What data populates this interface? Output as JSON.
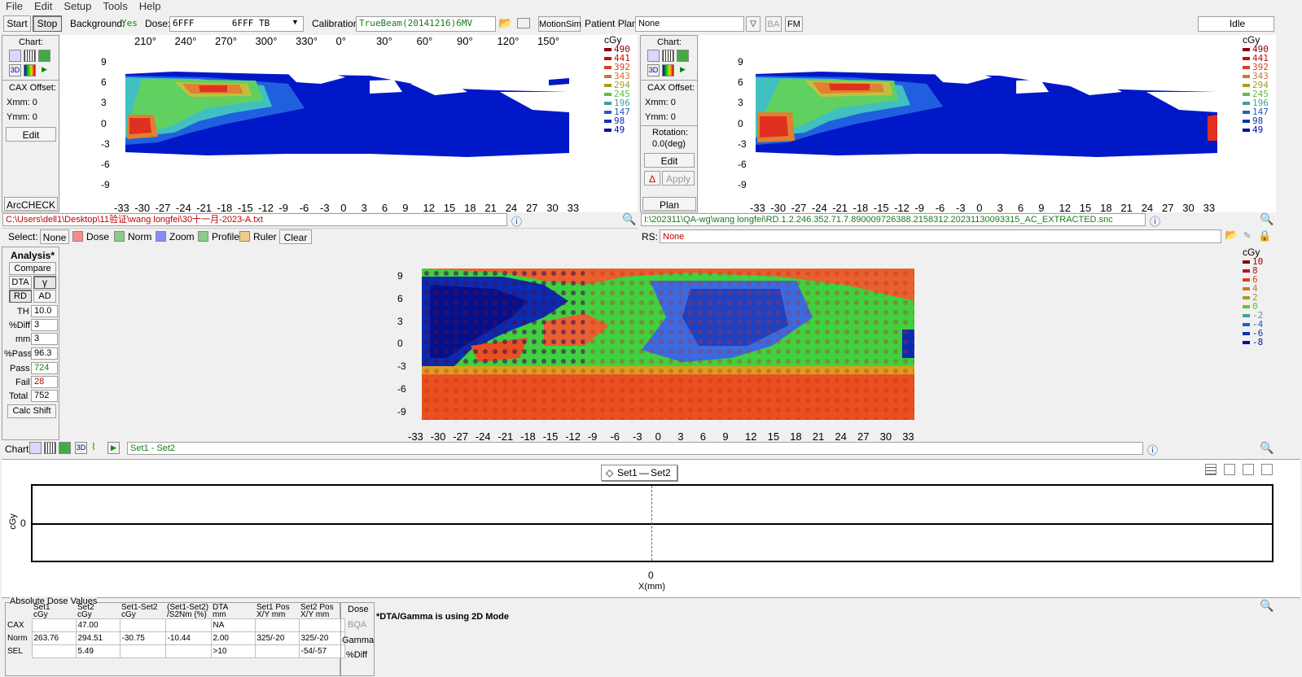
{
  "menu": [
    "File",
    "Edit",
    "Setup",
    "Tools",
    "Help"
  ],
  "toolbar": {
    "start": "Start",
    "stop": "Stop",
    "background_label": "Background:",
    "background_value": "Yes",
    "dose_label": "Dose:",
    "dose_value": "6FFF       6FFF TB",
    "calibration_label": "Calibration:",
    "calibration_value": "TrueBeam(20141216)6MV",
    "motionsim": "MotionSim",
    "patient_plan_label": "Patient Plan:",
    "patient_plan_value": "None",
    "ba": "BA",
    "fm": "FM",
    "status": "Idle"
  },
  "left_panel": {
    "chart_label": "Chart:",
    "cax_offset": "CAX Offset:",
    "xmm": "Xmm: 0",
    "ymm": "Ymm: 0",
    "edit": "Edit",
    "arccheck": "ArcCHECK",
    "angle_ticks": [
      "210°",
      "240°",
      "270°",
      "300°",
      "330°",
      "0°",
      "30°",
      "60°",
      "90°",
      "120°",
      "150°"
    ],
    "y_ticks": [
      "9",
      "6",
      "3",
      "0",
      "-3",
      "-6",
      "-9"
    ],
    "x_ticks": [
      "-33",
      "-30",
      "-27",
      "-24",
      "-21",
      "-18",
      "-15",
      "-12",
      "-9",
      "-6",
      "-3",
      "0",
      "3",
      "6",
      "9",
      "12",
      "15",
      "18",
      "21",
      "24",
      "27",
      "30",
      "33"
    ],
    "file_path": "C:\\Users\\dell1\\Desktop\\11验证\\wang longfei\\30十一月-2023-A.txt",
    "select_label": "Select:",
    "select_none": "None",
    "select_dose": "Dose",
    "select_norm": "Norm",
    "select_zoom": "Zoom",
    "select_profile": "Profile",
    "select_ruler": "Ruler",
    "select_clear": "Clear"
  },
  "right_panel": {
    "chart_label": "Chart:",
    "cax_offset": "CAX Offset:",
    "xmm": "Xmm: 0",
    "ymm": "Ymm: 0",
    "rotation_label": "Rotation:",
    "rotation_value": "0.0(deg)",
    "edit": "Edit",
    "apply": "Apply",
    "plan": "Plan",
    "file_path": "I:\\202311\\QA-wg\\wang longfei\\RD.1.2.246.352.71.7.890009726388.2158312.20231130093315_AC_EXTRACTED.snc",
    "rs_label": "RS:",
    "rs_value": "None"
  },
  "dose_legend": {
    "unit": "cGy",
    "values": [
      "490",
      "441",
      "392",
      "343",
      "294",
      "245",
      "196",
      "147",
      "98",
      "49"
    ],
    "colors": [
      "#8b0000",
      "#c01010",
      "#d84020",
      "#c87830",
      "#a0a020",
      "#60c040",
      "#40a0a0",
      "#2060c0",
      "#1030b0",
      "#0010a0"
    ]
  },
  "analysis": {
    "title": "Analysis*",
    "compare": "Compare",
    "dta": "DTA",
    "gamma": "γ",
    "rd": "RD",
    "ad": "AD",
    "th_label": "TH",
    "th_value": "10.0",
    "diff_label": "%Diff",
    "diff_value": "3",
    "mm_label": "mm",
    "mm_value": "3",
    "pass_pct_label": "%Pass",
    "pass_pct_value": "96.3",
    "pass_label": "Pass",
    "pass_value": "724",
    "fail_label": "Fail",
    "fail_value": "28",
    "total_label": "Total",
    "total_value": "752",
    "calc_shift": "Calc Shift",
    "y_ticks": [
      "9",
      "6",
      "3",
      "0",
      "-3",
      "-6",
      "-9"
    ],
    "x_ticks": [
      "-33",
      "-30",
      "-27",
      "-24",
      "-21",
      "-18",
      "-15",
      "-12",
      "-9",
      "-6",
      "-3",
      "0",
      "3",
      "6",
      "9",
      "12",
      "15",
      "18",
      "21",
      "24",
      "27",
      "30",
      "33"
    ],
    "chart_label": "Chart:",
    "set_label": "Set1 - Set2",
    "diff_legend": {
      "unit": "cGy",
      "values": [
        "10",
        "8",
        "6",
        "4",
        "2",
        "0",
        "-2",
        "-4",
        "-6",
        "-8"
      ],
      "colors": [
        "#8b0000",
        "#c01010",
        "#d84020",
        "#c87830",
        "#a0a020",
        "#60c040",
        "#40a0a0",
        "#2060c0",
        "#1030b0",
        "#0010a0"
      ]
    }
  },
  "profile": {
    "legend_set1": "Set1",
    "legend_set2": "Set2",
    "ylabel": "cGy",
    "y0": "0",
    "x0": "0",
    "xlabel": "X(mm)"
  },
  "bottom": {
    "group_title": "Absolute Dose Values",
    "headers": [
      [
        "Set1",
        "cGy"
      ],
      [
        "Set2",
        "cGy"
      ],
      [
        "Set1-Set2",
        "cGy"
      ],
      [
        "(Set1-Set2)",
        "/S2Nm (%)"
      ],
      [
        "DTA",
        "mm"
      ],
      [
        "Set1 Pos",
        "X/Y mm"
      ],
      [
        "Set2 Pos",
        "X/Y mm"
      ]
    ],
    "rows": [
      {
        "label": "CAX",
        "values": [
          "",
          "47.00",
          "",
          "",
          "NA",
          "",
          ""
        ]
      },
      {
        "label": "Norm",
        "values": [
          "263.76",
          "294.51",
          "-30.75",
          "-10.44",
          "2.00",
          "325/-20",
          "325/-20"
        ]
      },
      {
        "label": "SEL",
        "values": [
          "",
          "5.49",
          "",
          "",
          ">10",
          "",
          "-54/-57"
        ]
      }
    ],
    "mode_dose": "Dose",
    "mode_bqa": "BQA",
    "mode_gamma": "Gamma",
    "mode_diff": "%Diff",
    "note": "*DTA/Gamma is using 2D Mode"
  }
}
